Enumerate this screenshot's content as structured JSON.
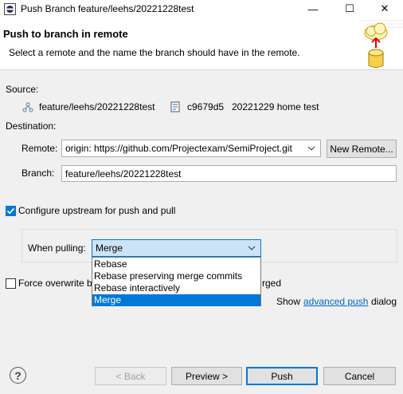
{
  "window": {
    "title": "Push Branch feature/leehs/20221228test",
    "minimize": "—",
    "maximize": "☐",
    "close": "✕"
  },
  "header": {
    "title": "Push to branch in remote",
    "description": "Select a remote and the name the branch should have in the remote."
  },
  "source": {
    "label": "Source:",
    "branch": "feature/leehs/20221228test",
    "commit_id": "c9679d5",
    "commit_message": "20221229 home test"
  },
  "destination": {
    "label": "Destination:",
    "remote_label": "Remote:",
    "remote_value": "origin: https://github.com/Projectexam/SemiProject.git",
    "new_remote_button": "New Remote...",
    "branch_label": "Branch:",
    "branch_value": "feature/leehs/20221228test"
  },
  "upstream": {
    "checkbox_label": "Configure upstream for push and pull",
    "checked": true,
    "when_pulling_label": "When pulling:",
    "when_pulling_value": "Merge",
    "options": [
      "Rebase",
      "Rebase preserving merge commits",
      "Rebase interactively",
      "Merge"
    ],
    "selected_index": 3
  },
  "force": {
    "label_start": "Force overwrite b",
    "label_end": "rged",
    "checked": false
  },
  "advanced": {
    "prefix": "Show",
    "link": "advanced push",
    "suffix": "dialog"
  },
  "footer": {
    "help": "?",
    "back": "< Back",
    "preview": "Preview >",
    "push": "Push",
    "cancel": "Cancel"
  }
}
